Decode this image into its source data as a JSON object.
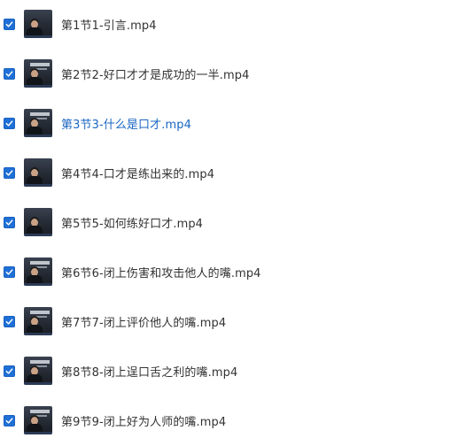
{
  "files": [
    {
      "name": "第1节1-引言.mp4",
      "checked": true,
      "active": false,
      "thumb_variant": "no-banner"
    },
    {
      "name": "第2节2-好口才才是成功的一半.mp4",
      "checked": true,
      "active": false,
      "thumb_variant": "banner"
    },
    {
      "name": "第3节3-什么是口才.mp4",
      "checked": true,
      "active": true,
      "thumb_variant": "banner"
    },
    {
      "name": "第4节4-口才是练出来的.mp4",
      "checked": true,
      "active": false,
      "thumb_variant": "no-banner"
    },
    {
      "name": "第5节5-如何练好口才.mp4",
      "checked": true,
      "active": false,
      "thumb_variant": "no-banner"
    },
    {
      "name": "第6节6-闭上伤害和攻击他人的嘴.mp4",
      "checked": true,
      "active": false,
      "thumb_variant": "banner"
    },
    {
      "name": "第7节7-闭上评价他人的嘴.mp4",
      "checked": true,
      "active": false,
      "thumb_variant": "banner"
    },
    {
      "name": "第8节8-闭上逞口舌之利的嘴.mp4",
      "checked": true,
      "active": false,
      "thumb_variant": "banner"
    },
    {
      "name": "第9节9-闭上好为人师的嘴.mp4",
      "checked": true,
      "active": false,
      "thumb_variant": "banner"
    }
  ],
  "colors": {
    "checkbox": "#1f6fd6",
    "text": "#333333",
    "active_text": "#1a66c2",
    "background": "#ffffff"
  },
  "icons": {
    "checkbox": "checkmark-icon",
    "thumbnail": "video-thumbnail"
  }
}
